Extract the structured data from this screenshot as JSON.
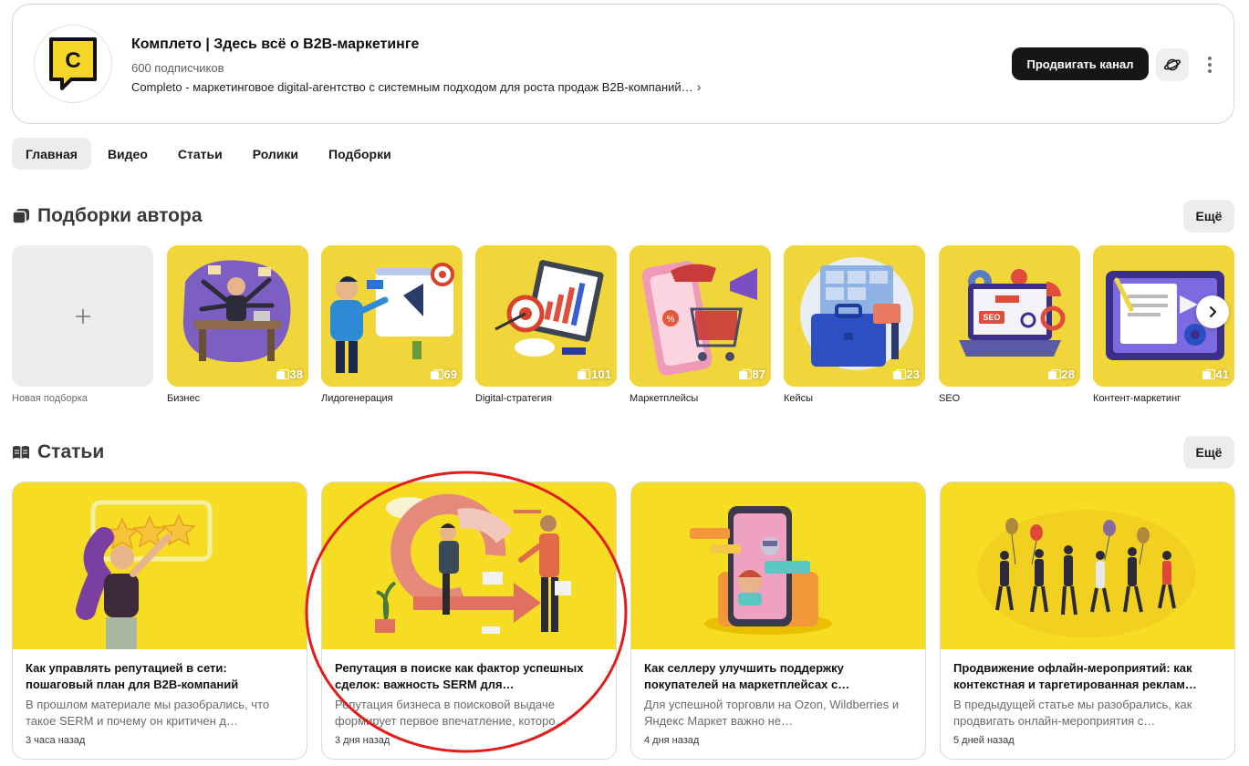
{
  "channel": {
    "title": "Комплето | Здесь всё о B2B-маркетинге",
    "subscribers": "600 подписчиков",
    "description": "Completo - маркетинговое digital-агентство с системным подходом для роста продаж B2B-компаний…",
    "avatar_letter": "C",
    "promote_label": "Продвигать канал",
    "brand_yellow": "#f5d629"
  },
  "tabs": [
    {
      "label": "Главная",
      "active": true
    },
    {
      "label": "Видео",
      "active": false
    },
    {
      "label": "Статьи",
      "active": false
    },
    {
      "label": "Ролики",
      "active": false
    },
    {
      "label": "Подборки",
      "active": false
    }
  ],
  "collections_section": {
    "title": "Подборки автора",
    "more_label": "Ещё",
    "new_label": "Новая подборка",
    "items": [
      {
        "label": "Бизнес",
        "count": "38",
        "icon": "businessman-desk-icon"
      },
      {
        "label": "Лидогенерация",
        "count": "69",
        "icon": "lead-generation-icon"
      },
      {
        "label": "Digital-стратегия",
        "count": "101",
        "icon": "target-chart-icon"
      },
      {
        "label": "Маркетплейсы",
        "count": "87",
        "icon": "shopping-cart-icon"
      },
      {
        "label": "Кейсы",
        "count": "23",
        "icon": "briefcase-icon"
      },
      {
        "label": "SEO",
        "count": "28",
        "icon": "seo-laptop-icon"
      },
      {
        "label": "Контент-маркетинг",
        "count": "41",
        "icon": "content-screen-icon"
      }
    ]
  },
  "articles_section": {
    "title": "Статьи",
    "more_label": "Ещё",
    "items": [
      {
        "title": "Как управлять репутацией в сети: пошаговый план для B2B-компаний",
        "snippet": "В прошлом материале мы разобрались, что такое SERM и почему он критичен д…",
        "time": "3 часа назад"
      },
      {
        "title": "Репутация в поиске как фактор успешных сделок: важность SERM для…",
        "snippet": "Репутация бизнеса в поисковой выдаче формирует первое впечатление, которо…",
        "time": "3 дня назад"
      },
      {
        "title": "Как селлеру улучшить поддержку покупателей на маркетплейсах с…",
        "snippet": "Для успешной торговли на Ozon, Wildberries и Яндекс Маркет важно не…",
        "time": "4 дня назад"
      },
      {
        "title": "Продвижение офлайн-мероприятий: как контекстная и таргетированная реклам…",
        "snippet": "В предыдущей статье мы разобрались, как продвигать онлайн-мероприятия с…",
        "time": "5 дней назад"
      }
    ]
  },
  "highlight_color": "#e21b1b"
}
